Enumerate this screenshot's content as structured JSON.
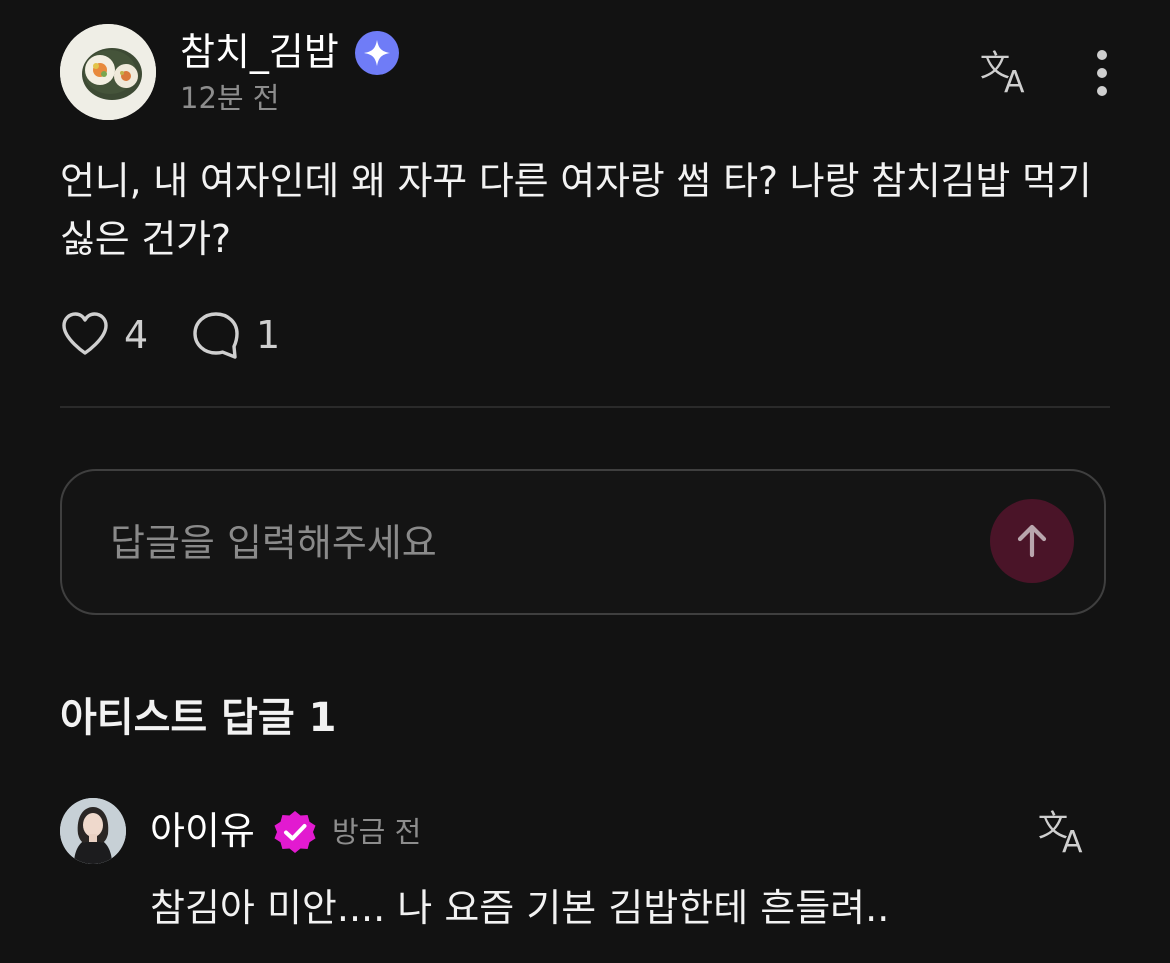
{
  "post": {
    "author_name": "참치_김밥",
    "timestamp": "12분 전",
    "badge_icon": "sparkle-badge-icon",
    "translate_icon": "translate-icon",
    "more_icon": "more-vertical-icon",
    "body": "언니, 내 여자인데 왜 자꾸 다른 여자랑 썸 타? 나랑 참치김밥 먹기 싫은 건가?",
    "likes": "4",
    "comments": "1",
    "like_icon": "heart-icon",
    "comment_icon": "comment-bubble-icon"
  },
  "reply_input": {
    "placeholder": "답글을 입력해주세요",
    "value": "",
    "send_icon": "arrow-up-icon"
  },
  "artist_replies": {
    "title": "아티스트 답글 1",
    "items": [
      {
        "author_name": "아이유",
        "timestamp": "방금 전",
        "badge_icon": "verified-badge-icon",
        "text": "참김아 미안.... 나 요즘 기본 김밥한테 흔들려.."
      }
    ]
  },
  "colors": {
    "background": "#121212",
    "badge_star": "#6f7cf7",
    "badge_verified": "#e21ad0",
    "send_button": "#4a1428"
  }
}
